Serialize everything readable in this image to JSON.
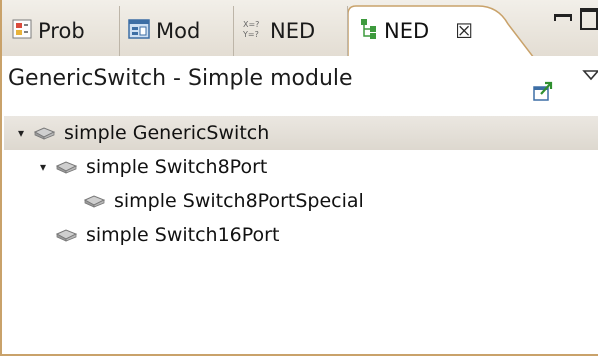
{
  "tabs": [
    {
      "label": "Prob",
      "icon": "problems-icon"
    },
    {
      "label": "Mod",
      "icon": "module-icon"
    },
    {
      "label": "NED",
      "icon": "ned-parameters-icon"
    },
    {
      "label": "NED",
      "icon": "type-hierarchy-icon",
      "active": true
    }
  ],
  "header": {
    "title": "GenericSwitch - Simple module"
  },
  "tree": [
    {
      "label": "simple GenericSwitch",
      "expanded": true,
      "selected": true
    },
    {
      "label": "simple Switch8Port",
      "expanded": true
    },
    {
      "label": "simple Switch8PortSpecial",
      "leaf": true
    },
    {
      "label": "simple Switch16Port",
      "leaf": true
    }
  ],
  "colors": {
    "accent": "#c9a26a",
    "tab_active": "#ffffff",
    "selection": "#e2ddd5"
  }
}
